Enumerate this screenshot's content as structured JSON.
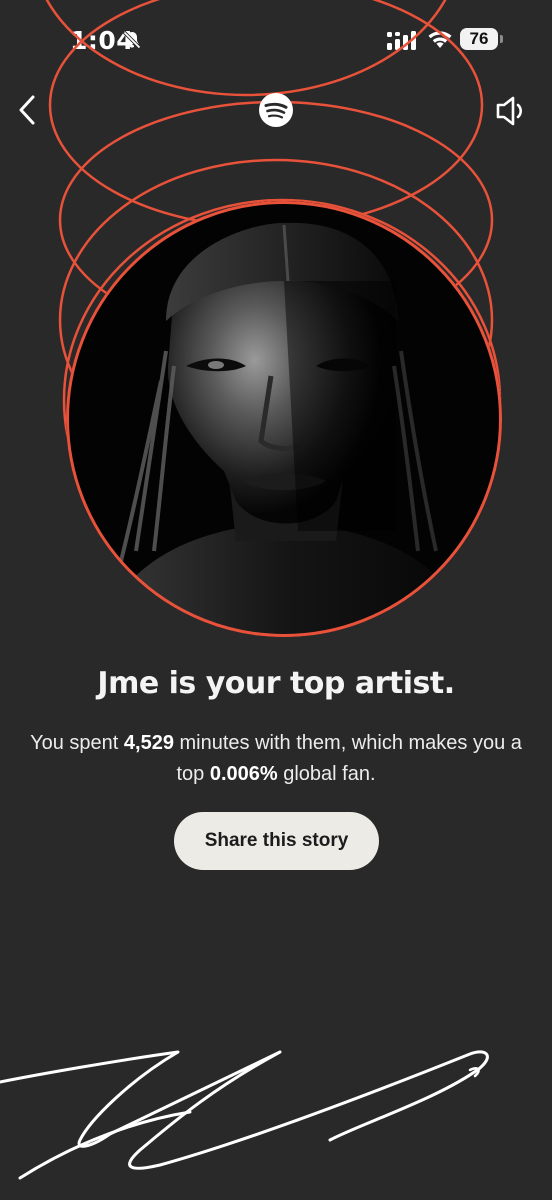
{
  "status_bar": {
    "time": "1:04",
    "battery": "76"
  },
  "header": {
    "back_icon": "chevron-left-icon",
    "logo_icon": "spotify-logo-icon",
    "sound_icon": "speaker-muted-icon"
  },
  "artist": {
    "photo_alt": "Jme"
  },
  "headline": "Jme is your top artist.",
  "summary": {
    "prefix": "You spent ",
    "minutes": "4,529",
    "middle": " minutes with them, which makes you a top ",
    "percent": "0.006%",
    "suffix": " global fan."
  },
  "share_button": {
    "label": "Share this story"
  },
  "colors": {
    "background": "#292929",
    "accent": "#e8523a",
    "button_bg": "#ecebe6"
  }
}
